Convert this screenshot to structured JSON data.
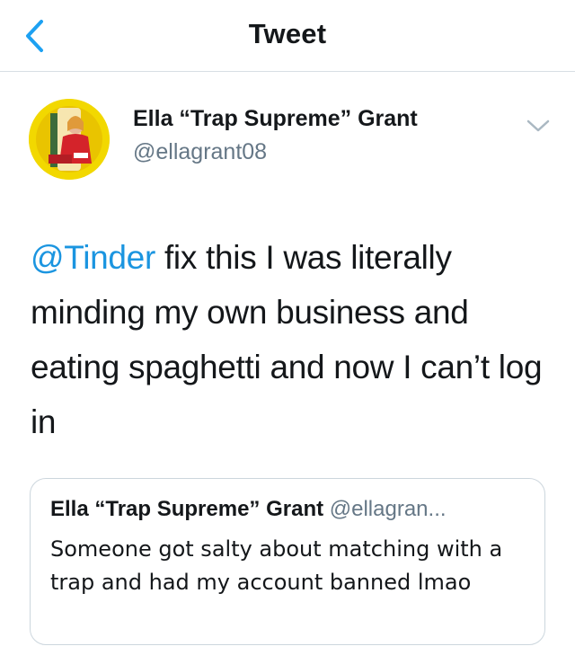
{
  "nav": {
    "title": "Tweet",
    "back_icon": "chevron-left-icon"
  },
  "author": {
    "display_name": "Ella “Trap Supreme” Grant",
    "handle": "@ellagrant08",
    "avatar_bg": "#f2d800"
  },
  "tweet": {
    "mention": "@Tinder",
    "text": " fix this I was literally minding my own business and eating spaghetti and now I can’t log in"
  },
  "quote": {
    "display_name": "Ella “Trap Supreme” Grant",
    "handle": "@ellagran...",
    "text": "Someone got salty about matching with a trap and had my account banned lmao"
  },
  "colors": {
    "accent": "#1b95e0",
    "secondary_text": "#657786",
    "divider": "#d8dee4"
  }
}
